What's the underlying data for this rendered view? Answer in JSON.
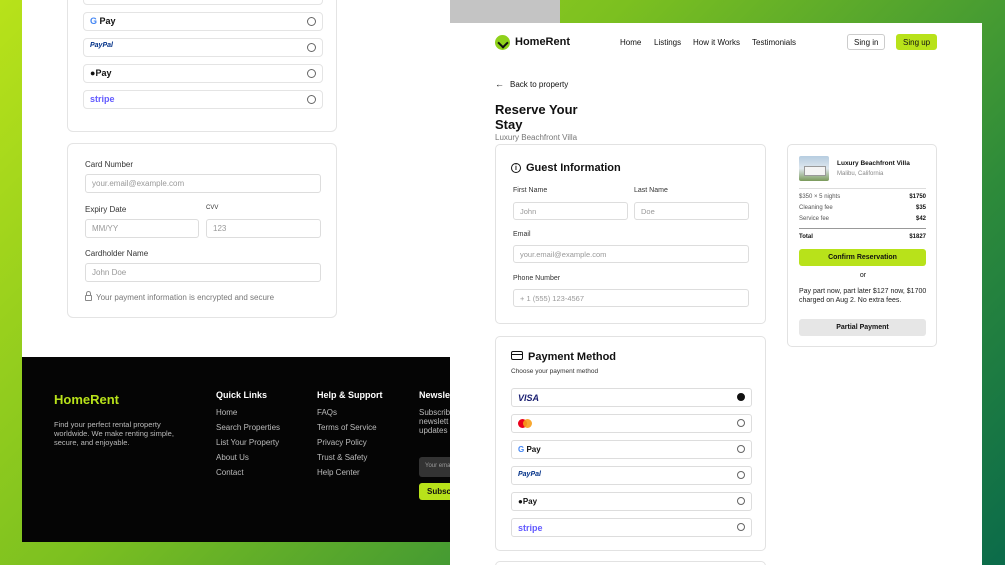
{
  "back_page": {
    "payment_options": [
      {
        "id": "mastercard",
        "label": "",
        "icon": "mastercard-icon"
      },
      {
        "id": "gpay",
        "label": "Pay",
        "icon": "google-g-icon"
      },
      {
        "id": "paypal",
        "label": "PayPal"
      },
      {
        "id": "applepay",
        "label": "Pay",
        "icon": "apple-icon"
      },
      {
        "id": "stripe",
        "label": "stripe"
      }
    ],
    "card_form": {
      "card_number_label": "Card Number",
      "card_number_placeholder": "your.email@example.com",
      "expiry_label": "Expiry Date",
      "expiry_placeholder": "MM/YY",
      "cvv_label": "CVV",
      "cvv_placeholder": "123",
      "holder_label": "Cardholder Name",
      "holder_placeholder": "John Doe",
      "secure_note": "Your payment information is encrypted and secure"
    },
    "footer": {
      "brand": "HomeRent",
      "description": "Find your perfect rental property worldwide. We make renting simple, secure, and enjoyable.",
      "quick_links_title": "Quick Links",
      "quick_links": [
        "Home",
        "Search Properties",
        "List Your Property",
        "About Us",
        "Contact"
      ],
      "support_title": "Help & Support",
      "support_links": [
        "FAQs",
        "Terms of Service",
        "Privacy Policy",
        "Trust & Safety",
        "Help Center"
      ],
      "newsletter_title": "Newsle",
      "newsletter_text": "Subscrib newslett updates",
      "newsletter_placeholder": "Your email",
      "newsletter_button": "Subsc"
    }
  },
  "nav": {
    "brand": "HomeRent",
    "links": [
      "Home",
      "Listings",
      "How it Works",
      "Testimonials"
    ],
    "sign_in": "Sing in",
    "sign_up": "Sing up"
  },
  "page": {
    "back_link": "Back to property",
    "title": "Reserve Your Stay",
    "subtitle": "Luxury Beachfront Villa"
  },
  "guest": {
    "title": "Guest Information",
    "first_name_label": "First Name",
    "first_name_placeholder": "John",
    "last_name_label": "Last Name",
    "last_name_placeholder": "Doe",
    "email_label": "Email",
    "email_placeholder": "your.email@example.com",
    "phone_label": "Phone Number",
    "phone_placeholder": "+ 1 (555)  123-4567"
  },
  "payment": {
    "title": "Payment Method",
    "subtitle": "Choose your payment method",
    "options": [
      {
        "id": "visa",
        "label": "VISA",
        "selected": true
      },
      {
        "id": "mastercard",
        "label": "",
        "selected": false
      },
      {
        "id": "gpay",
        "label": "Pay",
        "selected": false
      },
      {
        "id": "paypal",
        "label": "PayPal",
        "selected": false
      },
      {
        "id": "applepay",
        "label": "Pay",
        "selected": false
      },
      {
        "id": "stripe",
        "label": "stripe",
        "selected": false
      }
    ]
  },
  "summary": {
    "property_name": "Luxury Beachfront Villa",
    "location": "Malibu, California",
    "rows": [
      {
        "label": "$350 ×  5 nights",
        "value": "$1750"
      },
      {
        "label": "Cleaning fee",
        "value": "$35"
      },
      {
        "label": "Service fee",
        "value": "$42"
      }
    ],
    "total_label": "Total",
    "total_value": "$1827",
    "confirm_button": "Confirm Reservation",
    "or_text": "or",
    "partial_text": "Pay part now, part later $127 now, $1700 charged on Aug 2. No extra fees.",
    "partial_button": "Partial Payment"
  },
  "colors": {
    "accent": "#b8e21a",
    "footer_bg": "#050505"
  }
}
